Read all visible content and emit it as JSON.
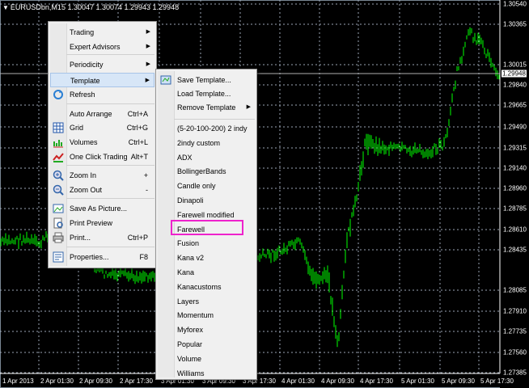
{
  "chart": {
    "title": "EURUSDbn,M15  1.30047 1.30074 1.29943 1.29948",
    "current_price": "1.29948",
    "y_labels": [
      "1.30540",
      "1.30365",
      "1.30015",
      "1.29840",
      "1.29665",
      "1.29490",
      "1.29315",
      "1.29140",
      "1.28960",
      "1.28785",
      "1.28610",
      "1.28435",
      "1.28085",
      "1.27910",
      "1.27735",
      "1.27560",
      "1.27385"
    ],
    "x_labels": [
      "1 Apr 2013",
      "2 Apr 01:30",
      "2 Apr 09:30",
      "2 Apr 17:30",
      "3 Apr 01:30",
      "3 Apr 09:30",
      "3 Apr 17:30",
      "4 Apr 01:30",
      "4 Apr 09:30",
      "4 Apr 17:30",
      "5 Apr 01:30",
      "5 Apr 09:30",
      "5 Apr 17:30"
    ],
    "bar_color": "#00ff00"
  },
  "context_menu": {
    "items": [
      {
        "label": "Trading",
        "arrow": true
      },
      {
        "label": "Expert Advisors",
        "arrow": true
      },
      {
        "label": "Periodicity",
        "arrow": true
      },
      {
        "label": "Template",
        "arrow": true,
        "highlighted": true
      },
      {
        "label": "Refresh",
        "icon": "refresh-icon"
      },
      {
        "label": "Auto Arrange",
        "shortcut": "Ctrl+A"
      },
      {
        "label": "Grid",
        "shortcut": "Ctrl+G",
        "icon": "grid-icon"
      },
      {
        "label": "Volumes",
        "shortcut": "Ctrl+L",
        "icon": "volumes-icon"
      },
      {
        "label": "One Click Trading",
        "shortcut": "Alt+T",
        "icon": "one-click-trading-icon"
      },
      {
        "label": "Zoom In",
        "shortcut": "+",
        "icon": "zoom-in-icon"
      },
      {
        "label": "Zoom Out",
        "shortcut": "-",
        "icon": "zoom-out-icon"
      },
      {
        "label": "Save As Picture...",
        "icon": "save-picture-icon"
      },
      {
        "label": "Print Preview",
        "icon": "print-preview-icon"
      },
      {
        "label": "Print...",
        "shortcut": "Ctrl+P",
        "icon": "printer-icon"
      },
      {
        "label": "Properties...",
        "shortcut": "F8",
        "icon": "properties-icon"
      }
    ]
  },
  "template_submenu": {
    "actions": [
      {
        "label": "Save Template...",
        "icon": "save-template-icon"
      },
      {
        "label": "Load Template..."
      },
      {
        "label": "Remove Template",
        "arrow": true
      }
    ],
    "templates": [
      "(5-20-100-200) 2 indy",
      "2indy custom",
      "ADX",
      "BollingerBands",
      "Candle only",
      "Dinapoli",
      "Farewell modified",
      "Farewell",
      "Fusion",
      "Kana v2",
      "Kana",
      "Kanacustoms",
      "Layers",
      "Momentum",
      "Myforex",
      "Popular",
      "Volume",
      "Williams"
    ],
    "marked_template": "Farewell",
    "mark_color": "#ee22cc"
  }
}
